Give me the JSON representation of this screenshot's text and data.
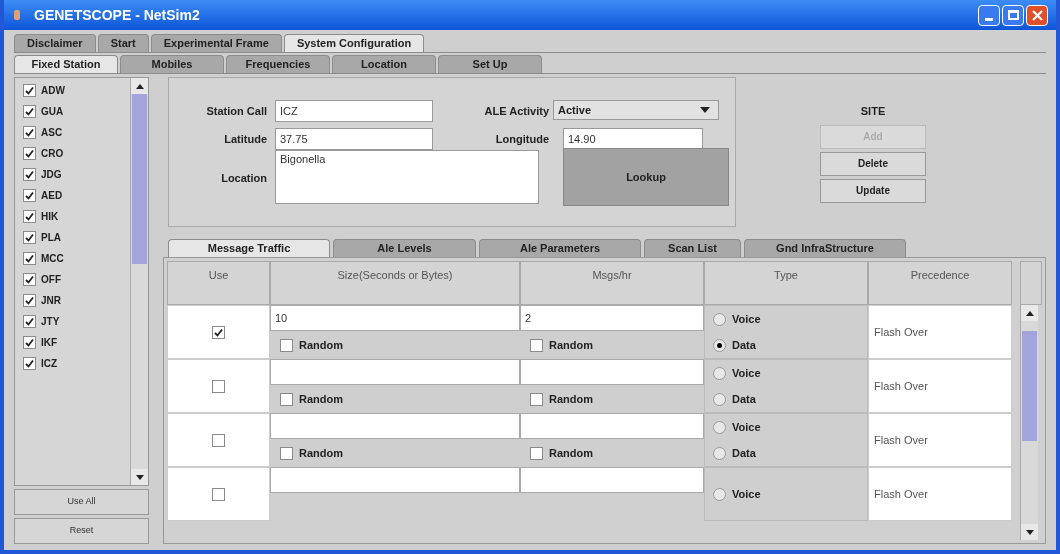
{
  "window": {
    "title": "GENETSCOPE - NetSim2"
  },
  "main_tabs": [
    {
      "label": "Disclaimer",
      "selected": false
    },
    {
      "label": "Start",
      "selected": false
    },
    {
      "label": "Experimental Frame",
      "selected": false
    },
    {
      "label": "System Configuration",
      "selected": true
    }
  ],
  "sub_tabs": [
    {
      "label": "Fixed Station",
      "selected": true
    },
    {
      "label": "Mobiles",
      "selected": false
    },
    {
      "label": "Frequencies",
      "selected": false
    },
    {
      "label": "Location",
      "selected": false
    },
    {
      "label": "Set Up",
      "selected": false
    }
  ],
  "stations": [
    {
      "label": "ADW",
      "checked": true
    },
    {
      "label": "GUA",
      "checked": true
    },
    {
      "label": "ASC",
      "checked": true
    },
    {
      "label": "CRO",
      "checked": true
    },
    {
      "label": "JDG",
      "checked": true
    },
    {
      "label": "AED",
      "checked": true
    },
    {
      "label": "HIK",
      "checked": true
    },
    {
      "label": "PLA",
      "checked": true
    },
    {
      "label": "MCC",
      "checked": true
    },
    {
      "label": "OFF",
      "checked": true
    },
    {
      "label": "JNR",
      "checked": true
    },
    {
      "label": "JTY",
      "checked": true
    },
    {
      "label": "IKF",
      "checked": true
    },
    {
      "label": "ICZ",
      "checked": true
    }
  ],
  "station_buttons": [
    "Use All",
    "Reset"
  ],
  "form": {
    "station_call": {
      "label": "Station Call",
      "value": "ICZ"
    },
    "ale_activity": {
      "label": "ALE Activity",
      "value": "Active"
    },
    "latitude": {
      "label": "Latitude",
      "value": "37.75"
    },
    "longitude": {
      "label": "Longitude",
      "value": "14.90"
    },
    "location": {
      "label": "Location",
      "value": "Bigonella"
    },
    "lookup_button": "Lookup"
  },
  "site": {
    "title": "SITE",
    "buttons": [
      {
        "label": "Add",
        "disabled": true
      },
      {
        "label": "Delete",
        "disabled": false
      },
      {
        "label": "Update",
        "disabled": false
      }
    ]
  },
  "traffic_tabs": [
    {
      "label": "Message Traffic",
      "selected": true
    },
    {
      "label": "Ale Levels",
      "selected": false
    },
    {
      "label": "Ale Parameters",
      "selected": false
    },
    {
      "label": "Scan List",
      "selected": false
    },
    {
      "label": "Gnd InfraStructure",
      "selected": false
    }
  ],
  "table": {
    "columns": [
      "Use",
      "Size(Seconds or Bytes)",
      "Msgs/hr",
      "Type",
      "Precedence"
    ],
    "rows": [
      {
        "use": true,
        "size": "10",
        "size_random": {
          "label": "Random",
          "checked": false
        },
        "msgs": "2",
        "msgs_random": {
          "label": "Random",
          "checked": false
        },
        "types": [
          {
            "label": "Voice",
            "selected": false
          },
          {
            "label": "Data",
            "selected": true
          }
        ],
        "precedence": "Flash Over"
      },
      {
        "use": false,
        "size": "",
        "size_random": {
          "label": "Random",
          "checked": false
        },
        "msgs": "",
        "msgs_random": {
          "label": "Random",
          "checked": false
        },
        "types": [
          {
            "label": "Voice",
            "selected": false
          },
          {
            "label": "Data",
            "selected": false
          }
        ],
        "precedence": "Flash Over"
      },
      {
        "use": false,
        "size": "",
        "size_random": {
          "label": "Random",
          "checked": false
        },
        "msgs": "",
        "msgs_random": {
          "label": "Random",
          "checked": false
        },
        "types": [
          {
            "label": "Voice",
            "selected": false
          },
          {
            "label": "Data",
            "selected": false
          }
        ],
        "precedence": "Flash Over"
      },
      {
        "use": false,
        "size": "",
        "msgs": "",
        "types": [
          {
            "label": "Voice",
            "selected": false
          }
        ],
        "precedence": "Flash Over"
      }
    ]
  }
}
